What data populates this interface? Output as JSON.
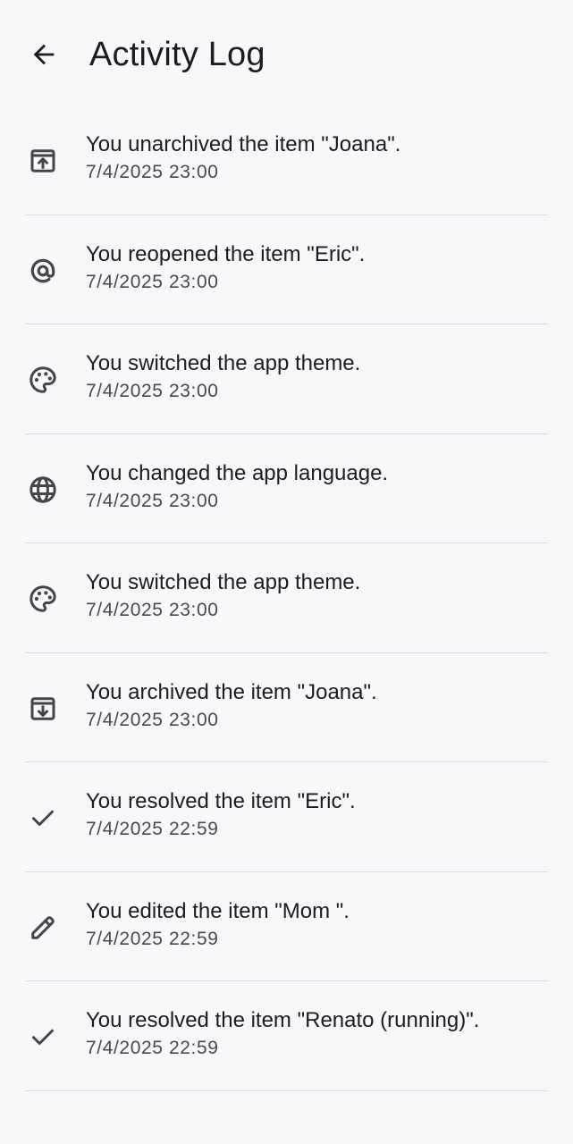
{
  "header": {
    "title": "Activity Log",
    "back_icon": "arrow-back-icon"
  },
  "colors": {
    "background": "#f8f7f9",
    "text_primary": "#1d1b20",
    "text_secondary": "#4a4752",
    "icon": "#46434f",
    "divider": "#dedce2"
  },
  "activities": [
    {
      "icon": "unarchive-icon",
      "message": "You unarchived the item \"Joana\".",
      "time": "7/4/2025 23:00"
    },
    {
      "icon": "alternate-email-icon",
      "message": "You reopened the item \"Eric\".",
      "time": "7/4/2025 23:00"
    },
    {
      "icon": "palette-icon",
      "message": "You switched the app theme.",
      "time": "7/4/2025 23:00"
    },
    {
      "icon": "language-icon",
      "message": "You changed the app language.",
      "time": "7/4/2025 23:00"
    },
    {
      "icon": "palette-icon",
      "message": "You switched the app theme.",
      "time": "7/4/2025 23:00"
    },
    {
      "icon": "archive-icon",
      "message": "You archived the item \"Joana\".",
      "time": "7/4/2025 23:00"
    },
    {
      "icon": "check-icon",
      "message": "You resolved the item \"Eric\".",
      "time": "7/4/2025 22:59"
    },
    {
      "icon": "edit-icon",
      "message": "You edited the item \"Mom \".",
      "time": "7/4/2025 22:59"
    },
    {
      "icon": "check-icon",
      "message": "You resolved the item \"Renato (running)\".",
      "time": "7/4/2025 22:59"
    }
  ]
}
